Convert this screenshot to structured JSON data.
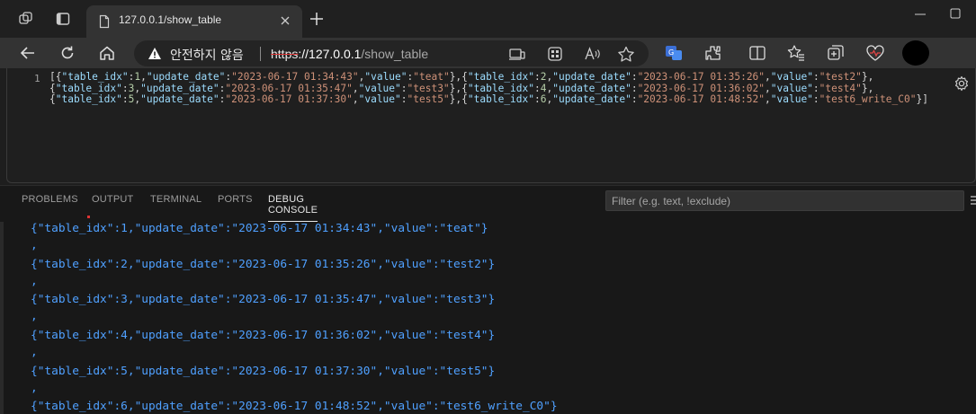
{
  "browser": {
    "tab_title": "127.0.0.1/show_table",
    "security_text": "안전하지 않음",
    "url_scheme": "https",
    "url_host": "://127.0.0.1",
    "url_path": "/show_table",
    "icons": [
      "workspaces-icon",
      "tab-actions-icon",
      "page-icon",
      "close-tab-icon",
      "new-tab-icon",
      "minimize-icon",
      "maximize-icon",
      "back-icon",
      "refresh-icon",
      "home-icon",
      "warning-icon",
      "app-available-icon",
      "grid-icon",
      "read-aloud-icon",
      "favorite-star-icon",
      "translate-icon",
      "extensions-icon",
      "split-screen-icon",
      "favorites-icon",
      "collections-icon",
      "browser-essentials-icon",
      "profile-avatar"
    ]
  },
  "editor": {
    "line_number": "1",
    "rows": [
      {
        "table_idx": "1",
        "update_date": "2023-06-17 01:34:43",
        "value": "teat"
      },
      {
        "table_idx": "2",
        "update_date": "2023-06-17 01:35:26",
        "value": "test2"
      },
      {
        "table_idx": "3",
        "update_date": "2023-06-17 01:35:47",
        "value": "test3"
      },
      {
        "table_idx": "4",
        "update_date": "2023-06-17 01:36:02",
        "value": "test4"
      },
      {
        "table_idx": "5",
        "update_date": "2023-06-17 01:37:30",
        "value": "test5"
      },
      {
        "table_idx": "6",
        "update_date": "2023-06-17 01:48:52",
        "value": "test6_write_C0"
      }
    ]
  },
  "panel": {
    "tabs": [
      "PROBLEMS",
      "OUTPUT",
      "TERMINAL",
      "PORTS",
      "DEBUG CONSOLE"
    ],
    "active_tab": "DEBUG CONSOLE",
    "filter_placeholder": "Filter (e.g. text, !exclude)",
    "console_lines": [
      "{\"table_idx\":1,\"update_date\":\"2023-06-17 01:34:43\",\"value\":\"teat\"}",
      "{\"table_idx\":2,\"update_date\":\"2023-06-17 01:35:26\",\"value\":\"test2\"}",
      "{\"table_idx\":3,\"update_date\":\"2023-06-17 01:35:47\",\"value\":\"test3\"}",
      "{\"table_idx\":4,\"update_date\":\"2023-06-17 01:36:02\",\"value\":\"test4\"}",
      "{\"table_idx\":5,\"update_date\":\"2023-06-17 01:37:30\",\"value\":\"test5\"}",
      "{\"table_idx\":6,\"update_date\":\"2023-06-17 01:48:52\",\"value\":\"test6_write_C0\"}"
    ],
    "separator": ","
  },
  "colors": {
    "json_key": "#9cdcfe",
    "json_number": "#b5cea8",
    "json_string": "#ce9178",
    "console_text": "#4fa0ff"
  }
}
